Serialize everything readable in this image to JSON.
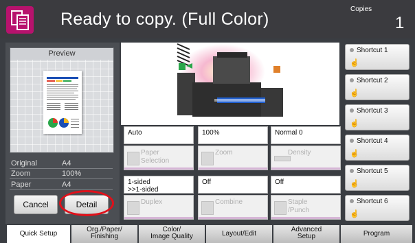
{
  "header": {
    "title": "Ready to copy. (Full Color)",
    "copies_label": "Copies",
    "copies_value": "1",
    "icon": "copy-icon"
  },
  "preview": {
    "title": "Preview",
    "info": [
      {
        "label": "Original",
        "value": "A4"
      },
      {
        "label": "Zoom",
        "value": "100%"
      },
      {
        "label": "Paper",
        "value": "A4"
      }
    ],
    "cancel_label": "Cancel",
    "detail_label": "Detail"
  },
  "settings": [
    {
      "value": "Auto",
      "label": "Paper\nSelection",
      "icon": "paper-icon"
    },
    {
      "value": "100%",
      "label": "Zoom",
      "icon": "zoom-icon"
    },
    {
      "value": "Normal 0",
      "label": "Density",
      "icon": "density-icon"
    },
    {
      "value": "1-sided\n>>1-sided",
      "label": "Duplex",
      "icon": "duplex-icon"
    },
    {
      "value": "Off",
      "label": "Combine",
      "icon": "combine-icon"
    },
    {
      "value": "Off",
      "label": "Staple\n/Punch",
      "icon": "staple-icon"
    }
  ],
  "shortcuts": [
    "Shortcut 1",
    "Shortcut 2",
    "Shortcut 3",
    "Shortcut 4",
    "Shortcut 5",
    "Shortcut 6"
  ],
  "tabs": [
    "Quick Setup",
    "Org./Paper/\nFinishing",
    "Color/\nImage Quality",
    "Layout/Edit",
    "Advanced\nSetup",
    "Program"
  ],
  "colors": {
    "accent": "#b7126d",
    "header": "#3b3b3f",
    "highlight": "#e0101a"
  }
}
